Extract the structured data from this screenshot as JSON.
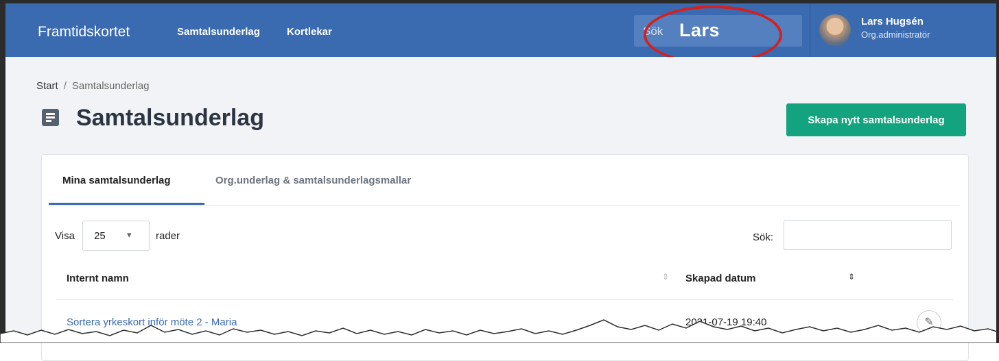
{
  "app": {
    "brand": "Framtidskortet",
    "nav_links": [
      "Samtalsunderlag",
      "Kortlekar"
    ],
    "search_placeholder": "Sök",
    "overlay_text": "Lars",
    "user": {
      "name": "Lars Hugsén",
      "role": "Org.administratör"
    }
  },
  "breadcrumb": {
    "home": "Start",
    "separator": "/",
    "current": "Samtalsunderlag"
  },
  "page": {
    "title": "Samtalsunderlag",
    "create_button": "Skapa nytt samtalsunderlag"
  },
  "tabs": [
    {
      "label": "Mina samtalsunderlag",
      "active": true
    },
    {
      "label": "Org.underlag & samtalsunderlagsmallar",
      "active": false
    }
  ],
  "table_controls": {
    "show_label": "Visa",
    "page_size": "25",
    "rows_label": "rader",
    "search_label": "Sök:",
    "search_value": ""
  },
  "table": {
    "columns": [
      "Internt namn",
      "Skapad datum"
    ],
    "rows": [
      {
        "name": "Sortera yrkeskort inför möte 2 - Maria",
        "date": "2021-07-19 19:40"
      }
    ]
  },
  "colors": {
    "navbar": "#3a6ab0",
    "primary_button": "#14a37f",
    "annotation": "#d32020"
  }
}
